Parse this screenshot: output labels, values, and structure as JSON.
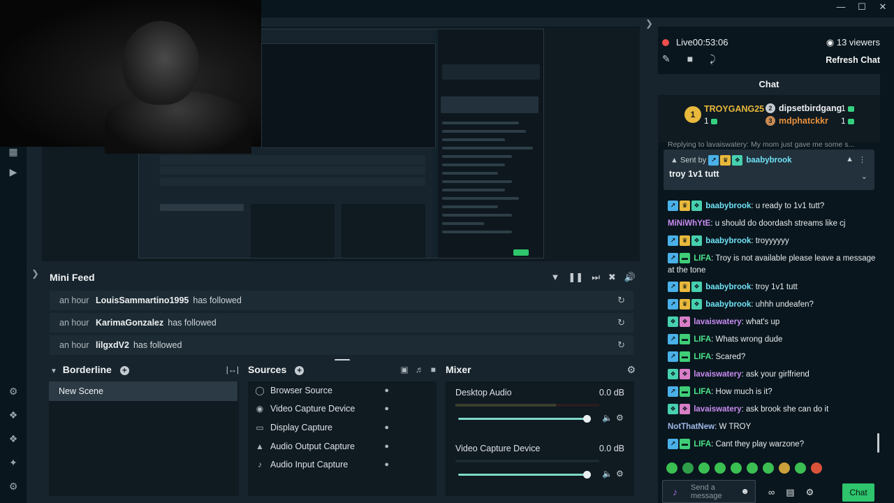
{
  "colors": {
    "accent_green": "#2ec56c",
    "live_red": "#f04d4d",
    "panel_dark": "#09161d",
    "panel_mid": "#17242d"
  },
  "stream": {
    "live_label": "Live",
    "time": "00:53:06",
    "viewers": "13 viewers",
    "refresh_label": "Refresh Chat"
  },
  "chat": {
    "title": "Chat",
    "leaderboard": [
      {
        "rank": "1",
        "name": "TROYGANG25",
        "count": "1"
      },
      {
        "rank": "2",
        "name": "dipsetbirdgang",
        "count": "1"
      },
      {
        "rank": "3",
        "name": "mdphatckkr",
        "count": "1"
      }
    ],
    "reply_strip": "Replying to lavaiswatery: My mom just gave me some s...",
    "pinned": {
      "sent_by": "Sent by",
      "user": "baabybrook",
      "message": "troy 1v1 tutt"
    },
    "messages": [
      {
        "user": "baabybrook",
        "text": "u ready to 1v1 tutt?"
      },
      {
        "user": "MiNiWhYtE",
        "text": "u should do doordash streams like cj"
      },
      {
        "user": "baabybrook",
        "text": "troyyyyyy"
      },
      {
        "user": "LIFA",
        "text": "Troy is not available please leave a message at the tone"
      },
      {
        "user": "baabybrook",
        "text": "troy 1v1 tutt"
      },
      {
        "user": "baabybrook",
        "text": "uhhh undeafen?"
      },
      {
        "user": "lavaiswatery",
        "text": "what's up"
      },
      {
        "user": "LIFA",
        "text": "Whats wrong dude"
      },
      {
        "user": "LIFA",
        "text": "Scared?"
      },
      {
        "user": "lavaiswatery",
        "text": "ask your girlfriend"
      },
      {
        "user": "LIFA",
        "text": "How much is it?"
      },
      {
        "user": "lavaiswatery",
        "text": "ask brook she can do it"
      },
      {
        "user": "NotThatNew",
        "text": "W TROY"
      },
      {
        "user": "LIFA",
        "text": "Cant they play warzone?"
      }
    ],
    "input_placeholder": "Send a message",
    "send_label": "Chat"
  },
  "minifeed": {
    "title": "Mini Feed",
    "events": [
      {
        "time": "an hour",
        "user": "LouisSammartino1995",
        "action": "has followed"
      },
      {
        "time": "an hour",
        "user": "KarimaGonzalez",
        "action": "has followed"
      },
      {
        "time": "an hour",
        "user": "lilgxdV2",
        "action": "has followed"
      }
    ]
  },
  "scenes": {
    "title": "Borderline",
    "items": [
      "New Scene"
    ]
  },
  "sources": {
    "title": "Sources",
    "items": [
      {
        "label": "Browser Source",
        "icon": "globe-icon"
      },
      {
        "label": "Video Capture Device",
        "icon": "camera-icon"
      },
      {
        "label": "Display Capture",
        "icon": "monitor-icon"
      },
      {
        "label": "Audio Output Capture",
        "icon": "speaker-icon"
      },
      {
        "label": "Audio Input Capture",
        "icon": "mic-icon"
      }
    ]
  },
  "mixer": {
    "title": "Mixer",
    "channels": [
      {
        "name": "Desktop Audio",
        "db": "0.0 dB",
        "level": 1.0
      },
      {
        "name": "Video Capture Device",
        "db": "0.0 dB",
        "level": 1.0
      }
    ]
  }
}
